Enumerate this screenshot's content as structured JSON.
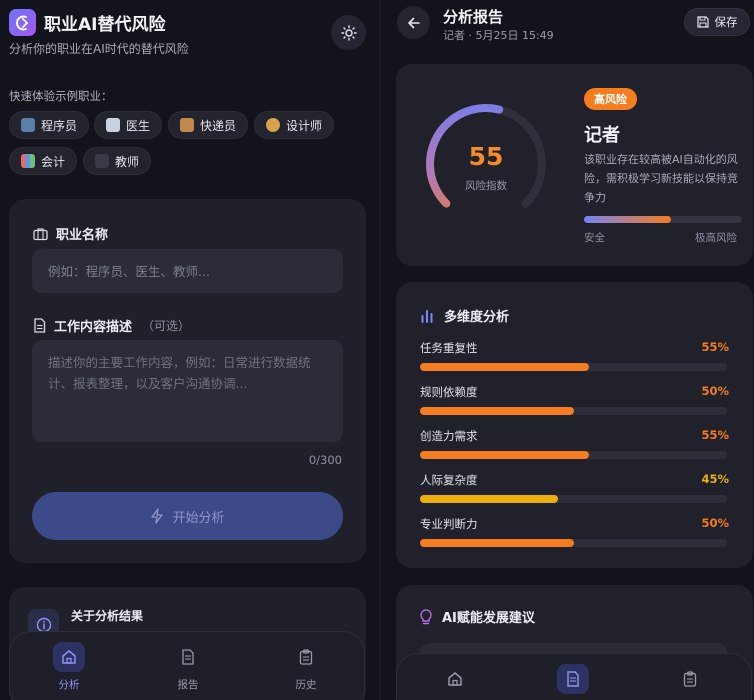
{
  "app": {
    "title": "职业AI替代风险",
    "subtitle": "分析你的职业在AI时代的替代风险",
    "theme_toggle_icon": "sun-icon"
  },
  "quick": {
    "label": "快速体验示例职业：",
    "chips": [
      {
        "emoji_icon": "robot-emoji",
        "label": "程序员"
      },
      {
        "emoji_icon": "hospital-emoji",
        "label": "医生"
      },
      {
        "emoji_icon": "package-emoji",
        "label": "快递员"
      },
      {
        "emoji_icon": "palette-emoji",
        "label": "设计师"
      },
      {
        "emoji_icon": "bar-chart-emoji",
        "label": "会计"
      },
      {
        "emoji_icon": "graduation-cap-emoji",
        "label": "教师"
      }
    ]
  },
  "form": {
    "job_label": "职业名称",
    "job_placeholder": "例如：程序员、医生、教师...",
    "desc_label": "工作内容描述",
    "desc_optional": "（可选）",
    "desc_placeholder": "描述你的主要工作内容，例如：日常进行数据统计、报表整理，以及客户沟通协调...",
    "counter": "0/300",
    "submit_label": "开始分析"
  },
  "about": {
    "title": "关于分析结果"
  },
  "nav": {
    "items": [
      {
        "label": "分析",
        "icon": "home-icon",
        "active": true
      },
      {
        "label": "报告",
        "icon": "document-icon",
        "active": false
      },
      {
        "label": "历史",
        "icon": "clipboard-icon",
        "active": false
      }
    ]
  },
  "report": {
    "title": "分析报告",
    "meta": "记者 · 5月25日 15:49",
    "save_label": "保存"
  },
  "risk": {
    "score": "55",
    "score_fraction": 0.55,
    "score_label": "风险指数",
    "badge": "高风险",
    "job": "记者",
    "description": "该职业存在较高被AI自动化的风险，需积极学习新技能以保持竞争力",
    "bar_fraction": 0.55,
    "low_label": "安全",
    "high_label": "极高风险",
    "accent": "#f57c1f"
  },
  "dimensions": {
    "title": "多维度分析",
    "items": [
      {
        "name": "任务重复性",
        "pct": "55%",
        "value": 0.55,
        "color": "#f57c1f"
      },
      {
        "name": "规则依赖度",
        "pct": "50%",
        "value": 0.5,
        "color": "#f57c1f"
      },
      {
        "name": "创造力需求",
        "pct": "55%",
        "value": 0.55,
        "color": "#f57c1f"
      },
      {
        "name": "人际复杂度",
        "pct": "45%",
        "value": 0.45,
        "color": "#ecb00c"
      },
      {
        "name": "专业判断力",
        "pct": "50%",
        "value": 0.5,
        "color": "#f57c1f"
      }
    ]
  },
  "advice": {
    "title": "AI赋能发展建议"
  }
}
